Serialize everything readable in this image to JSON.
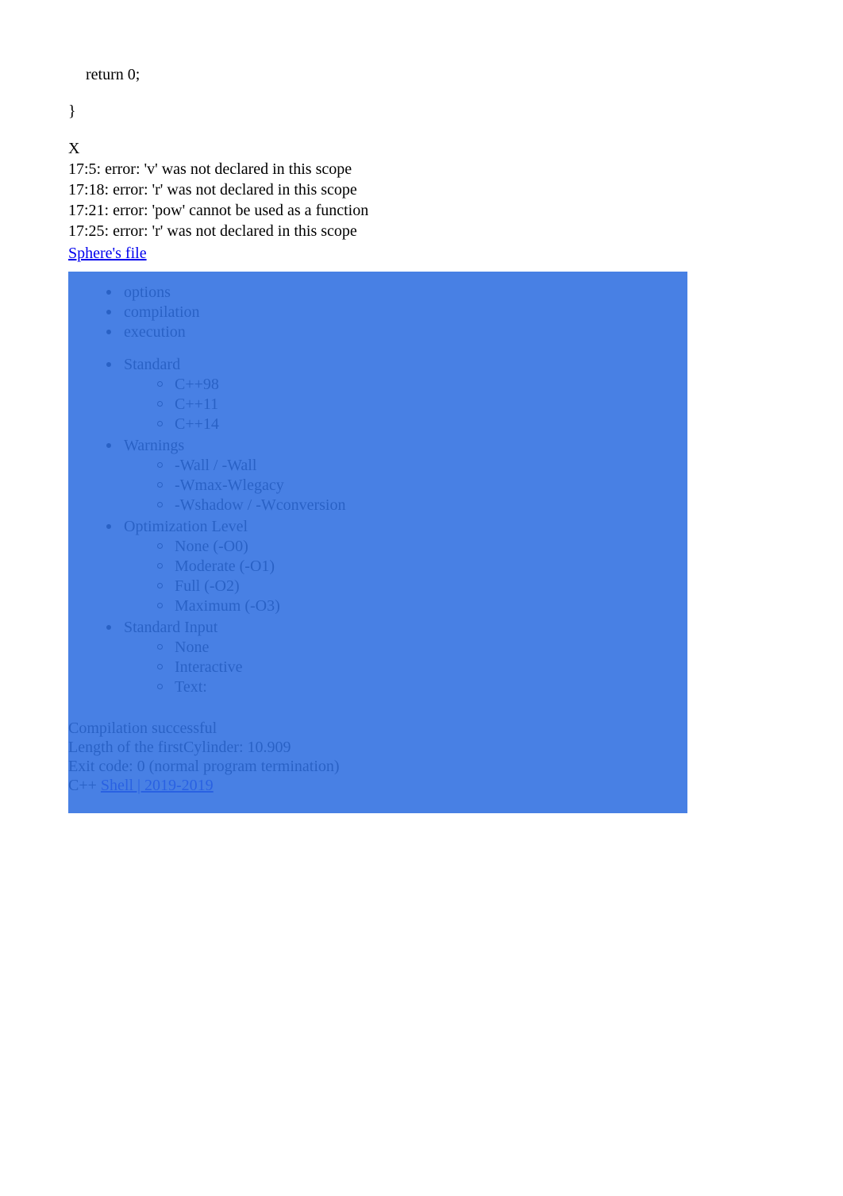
{
  "code": {
    "line1": "return 0;",
    "line2": "}"
  },
  "errors": {
    "x": "X",
    "lines": [
      "17:5: error: 'v' was not declared in this scope",
      "17:18: error: 'r' was not declared in this scope",
      "17:21: error: 'pow' cannot be used as a function",
      "17:25: error: 'r' was not declared in this scope"
    ]
  },
  "sphere_link": "Sphere's file",
  "menu": {
    "group1": [
      "options",
      "compilation",
      "execution"
    ],
    "group2": [
      {
        "label": "Standard",
        "items": [
          "C++98",
          "C++11",
          "C++14"
        ]
      },
      {
        "label": "Warnings",
        "items": [
          "-Wall / -Wall",
          "-Wmax-Wlegacy",
          "-Wshadow / -Wconversion"
        ]
      },
      {
        "label": "Optimization Level",
        "items": [
          "None (-O0)",
          "Moderate (-O1)",
          "Full (-O2)",
          "Maximum (-O3)"
        ]
      },
      {
        "label": "Standard Input",
        "items": [
          "None",
          "Interactive",
          "Text:"
        ]
      }
    ]
  },
  "footer": {
    "l1": "Compilation successful",
    "l2": "Length of the firstCylinder: 10.909",
    "l3": "Exit code: 0 (normal program termination)",
    "l4_prefix": "C++ ",
    "l4_link": "Shell | 2019-2019"
  }
}
